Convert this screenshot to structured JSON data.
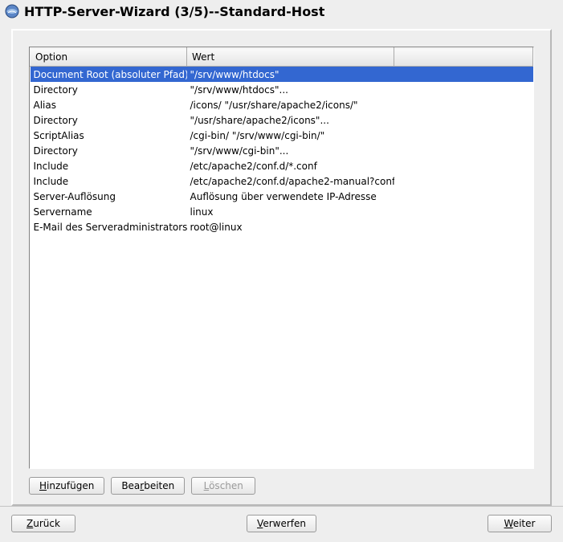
{
  "title": "HTTP-Server-Wizard (3/5)--Standard-Host",
  "table": {
    "headers": {
      "option": "Option",
      "wert": "Wert"
    },
    "rows": [
      {
        "option": "Document Root (absoluter Pfad)",
        "wert": "\"/srv/www/htdocs\"",
        "selected": true
      },
      {
        "option": "Directory",
        "wert": "\"/srv/www/htdocs\"..."
      },
      {
        "option": "Alias",
        "wert": "/icons/ \"/usr/share/apache2/icons/\""
      },
      {
        "option": "Directory",
        "wert": "\"/usr/share/apache2/icons\"..."
      },
      {
        "option": "ScriptAlias",
        "wert": "/cgi-bin/ \"/srv/www/cgi-bin/\""
      },
      {
        "option": "Directory",
        "wert": "\"/srv/www/cgi-bin\"..."
      },
      {
        "option": "Include",
        "wert": "/etc/apache2/conf.d/*.conf"
      },
      {
        "option": "Include",
        "wert": "/etc/apache2/conf.d/apache2-manual?conf"
      },
      {
        "option": "Server-Auflösung",
        "wert": "Auflösung über verwendete IP-Adresse"
      },
      {
        "option": "Servername",
        "wert": "linux"
      },
      {
        "option": "E-Mail des Serveradministrators",
        "wert": "root@linux"
      }
    ]
  },
  "buttons": {
    "add": {
      "full": "Hinzufügen",
      "pre": "",
      "mn": "H",
      "post": "inzufügen"
    },
    "edit": {
      "full": "Bearbeiten",
      "pre": "Bea",
      "mn": "r",
      "post": "beiten"
    },
    "delete": {
      "full": "Löschen",
      "pre": "",
      "mn": "L",
      "post": "öschen",
      "disabled": true
    }
  },
  "nav": {
    "back": {
      "full": "Zurück",
      "pre": "",
      "mn": "Z",
      "post": "urück"
    },
    "discard": {
      "full": "Verwerfen",
      "pre": "",
      "mn": "V",
      "post": "erwerfen"
    },
    "next": {
      "full": "Weiter",
      "pre": "",
      "mn": "W",
      "post": "eiter"
    }
  }
}
